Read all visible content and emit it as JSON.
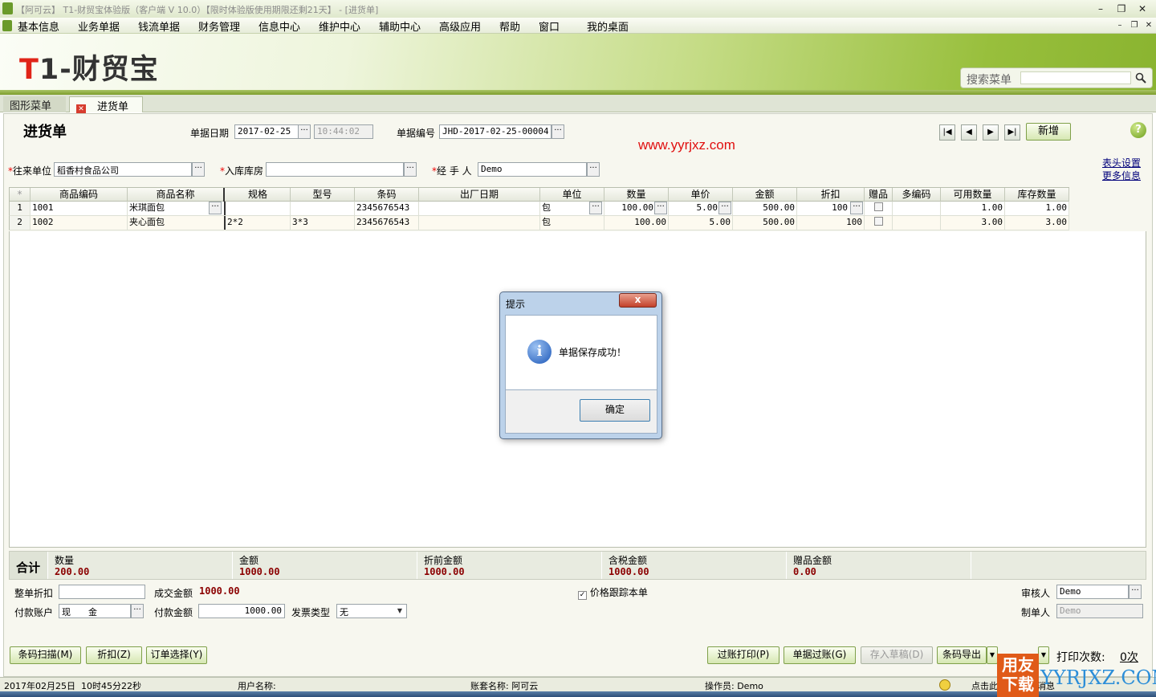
{
  "window": {
    "title": "【阿可云】 T1-财贸宝体验版（客户端 V 10.0）【限时体验版使用期限还剩21天】 - [进货单]",
    "min": "–",
    "max": "❐",
    "close": "✕"
  },
  "menu": [
    "基本信息",
    "业务单据",
    "钱流单据",
    "财务管理",
    "信息中心",
    "维护中心",
    "辅助中心",
    "高级应用",
    "帮助",
    "窗口",
    "我的桌面"
  ],
  "banner": {
    "logo_t": "T",
    "logo_rest": "1-财贸宝",
    "search_label": "搜索菜单"
  },
  "tabs": {
    "graphic_menu": "图形菜单",
    "purchase": "进货单"
  },
  "form": {
    "title": "进货单",
    "date_label": "单据日期",
    "date_value": "2017-02-25",
    "time_value": "10:44:02",
    "no_label": "单据编号",
    "no_value": "JHD-2017-02-25-00004",
    "partner_label": "往来单位",
    "partner_value": "稻香村食品公司",
    "warehouse_label": "入库库房",
    "warehouse_value": "",
    "handler_label": "经 手 人",
    "handler_value": "Demo",
    "new_button": "新增",
    "header_settings": "表头设置",
    "more_info": "更多信息",
    "watermark": "www.yyrjxz.com",
    "dots": "···",
    "nav": {
      "first": "|◀",
      "prev": "◀",
      "next": "▶",
      "last": "▶|"
    },
    "help": "?"
  },
  "grid": {
    "columns": [
      "*",
      "商品编码",
      "商品名称",
      "规格",
      "型号",
      "条码",
      "出厂日期",
      "单位",
      "数量",
      "单价",
      "金额",
      "折扣",
      "赠品",
      "多编码",
      "可用数量",
      "库存数量"
    ],
    "rows": [
      {
        "idx": "1",
        "code": "1001",
        "name": "米琪面包",
        "spec": "",
        "model": "",
        "barcode": "2345676543",
        "date": "",
        "unit": "包",
        "qty": "100.00",
        "price": "5.00",
        "amount": "500.00",
        "discount": "100",
        "gift": "",
        "multi": "",
        "avail": "1.00",
        "stock": "1.00"
      },
      {
        "idx": "2",
        "code": "1002",
        "name": "夹心面包",
        "spec": "2*2",
        "model": "3*3",
        "barcode": "2345676543",
        "date": "",
        "unit": "包",
        "qty": "100.00",
        "price": "5.00",
        "amount": "500.00",
        "discount": "100",
        "gift": "",
        "multi": "",
        "avail": "3.00",
        "stock": "3.00"
      }
    ]
  },
  "totals": {
    "label": "合计",
    "qty_label": "数量",
    "qty_value": "200.00",
    "amount_label": "金额",
    "amount_value": "1000.00",
    "pre_discount_label": "折前金额",
    "pre_discount_value": "1000.00",
    "tax_label": "含税金额",
    "tax_value": "1000.00",
    "gift_label": "赠品金额",
    "gift_value": "0.00"
  },
  "bottom": {
    "whole_discount_label": "整单折扣",
    "whole_discount_value": "",
    "deal_amount_label": "成交金额",
    "deal_amount_value": "1000.00",
    "price_track_label": "价格跟踪本单",
    "pay_account_label": "付款账户",
    "pay_account_value": "现　　金",
    "pay_amount_label": "付款金额",
    "pay_amount_value": "1000.00",
    "invoice_label": "发票类型",
    "invoice_value": "无",
    "reviewer_label": "审核人",
    "reviewer_value": "Demo",
    "maker_label": "制单人",
    "maker_value": "Demo"
  },
  "buttons": {
    "barcode_scan": "条码扫描(M)",
    "discount": "折扣(Z)",
    "order_select": "订单选择(Y)",
    "post_print": "过账打印(P)",
    "post": "单据过账(G)",
    "save_draft": "存入草稿(D)",
    "barcode_export": "条码导出",
    "print_count_label": "打印次数:",
    "print_count_value": "0次"
  },
  "status": {
    "date": "2017年02月25日",
    "time": "10时45分22秒",
    "user": "用户名称:",
    "account": "账套名称: 阿可云",
    "operator": "操作员: Demo",
    "tail": "点击此",
    "tail2": "消息"
  },
  "dialog": {
    "title": "提示",
    "message": "单据保存成功！",
    "ok": "确定",
    "close": "x",
    "icon": "i"
  },
  "brand": {
    "cn": "用友下载",
    "en": "YYRJXZ.COM"
  }
}
